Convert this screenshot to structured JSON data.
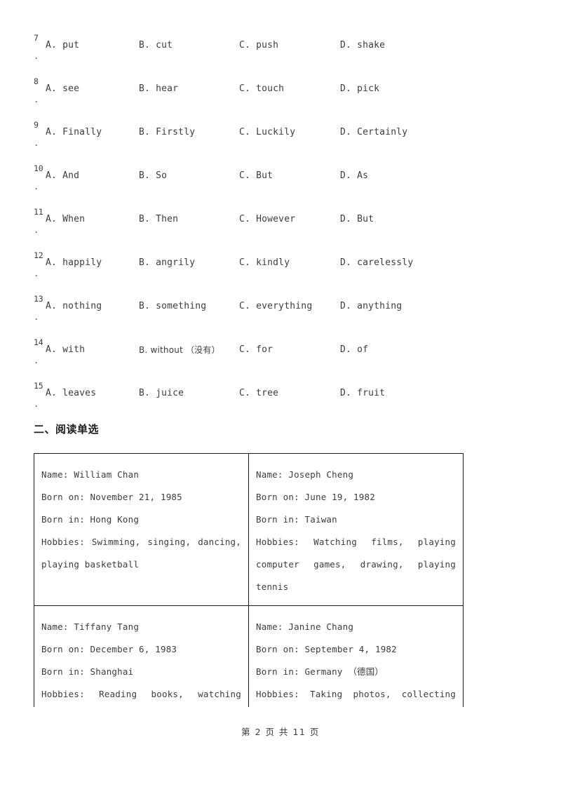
{
  "document": {
    "page_footer": "第 2 页 共 11 页"
  },
  "questions": [
    {
      "number": "7",
      "dot": ".",
      "options": [
        "A. put",
        "B. cut",
        "C. push",
        "D. shake"
      ]
    },
    {
      "number": "8",
      "dot": ".",
      "options": [
        "A. see",
        "B. hear",
        "C. touch",
        "D. pick"
      ]
    },
    {
      "number": "9",
      "dot": ".",
      "options": [
        "A. Finally",
        "B. Firstly",
        "C. Luckily",
        "D. Certainly"
      ]
    },
    {
      "number": "10",
      "dot": ".",
      "options": [
        "A. And",
        "B. So",
        "C. But",
        "D. As"
      ]
    },
    {
      "number": "11",
      "dot": ".",
      "options": [
        "A. When",
        "B. Then",
        "C. However",
        "D. But"
      ]
    },
    {
      "number": "12",
      "dot": ".",
      "options": [
        "A. happily",
        "B. angrily",
        "C. kindly",
        "D. carelessly"
      ]
    },
    {
      "number": "13",
      "dot": ".",
      "options": [
        "A. nothing",
        "B. something",
        "C. everything",
        "D. anything"
      ]
    },
    {
      "number": "14",
      "dot": ".",
      "options": [
        "A. with",
        "B. without （没有）",
        "C. for",
        "D. of"
      ]
    },
    {
      "number": "15",
      "dot": ".",
      "options": [
        "A. leaves",
        "B. juice",
        "C. tree",
        "D. fruit"
      ]
    }
  ],
  "section": {
    "heading": "二、阅读单选"
  },
  "profiles": [
    {
      "name": "Name: William Chan",
      "born_on": "Born on: November 21, 1985",
      "born_in": "Born in: Hong Kong",
      "hobbies_line1": "Hobbies: Swimming, singing, dancing,",
      "hobbies_line2": "playing basketball",
      "hobbies_line3": ""
    },
    {
      "name": "Name: Joseph Cheng",
      "born_on": "Born on: June 19, 1982",
      "born_in": "Born in: Taiwan",
      "hobbies_line1": "Hobbies: Watching films, playing",
      "hobbies_line2": "computer games, drawing, playing",
      "hobbies_line3": "tennis"
    },
    {
      "name": "Name: Tiffany Tang",
      "born_on": "Born on: December 6, 1983",
      "born_in": "Born in: Shanghai",
      "hobbies_line1": "Hobbies: Reading books, watching",
      "hobbies_line2": "",
      "hobbies_line3": ""
    },
    {
      "name": "Name: Janine Chang",
      "born_on": "Born on: September 4, 1982",
      "born_in": "Born in: Germany （德国）",
      "hobbies_line1": "Hobbies: Taking photos, collecting",
      "hobbies_line2": "",
      "hobbies_line3": ""
    }
  ]
}
